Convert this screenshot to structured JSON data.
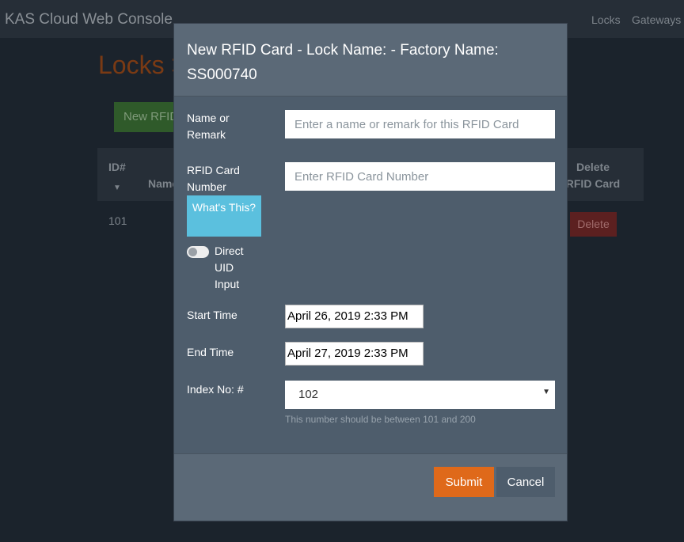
{
  "navbar": {
    "brand": "KAS Cloud Web Console",
    "links": [
      "Locks",
      "Gateways"
    ]
  },
  "page": {
    "title": "Locks >",
    "new_button": "New RFID",
    "table": {
      "headers": [
        "ID#",
        "Name",
        "Delete RFID Card"
      ],
      "sort_icon": "caret-down-icon",
      "rows": [
        {
          "id": "101",
          "delete": "Delete"
        }
      ]
    }
  },
  "modal": {
    "title": "New RFID Card - Lock Name: - Factory Name: SS000740",
    "name_label": "Name or Remark",
    "name_placeholder": "Enter a name or remark for this RFID Card",
    "name_value": "",
    "rfid_label": "RFID Card Number",
    "rfid_placeholder": "Enter RFID Card Number",
    "rfid_value": "",
    "whats_this": "What's This?",
    "direct_uid_label": "Direct UID Input",
    "direct_uid_on": false,
    "start_label": "Start Time",
    "start_value": "April 26, 2019 2:33 PM",
    "end_label": "End Time",
    "end_value": "April 27, 2019 2:33 PM",
    "index_label": "Index No: #",
    "index_value": "102",
    "index_help": "This number should be between 101 and 200",
    "submit": "Submit",
    "cancel": "Cancel"
  },
  "colors": {
    "accent": "#df691a",
    "info": "#5bc0de",
    "modal": "#4e5d6c"
  }
}
